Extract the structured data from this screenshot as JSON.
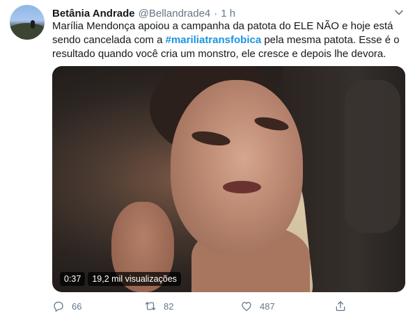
{
  "tweet": {
    "author": {
      "display_name": "Betânia Andrade",
      "handle": "@Bellandrade4",
      "separator": "·",
      "timestamp": "1 h",
      "avatar_icon": "avatar-photo"
    },
    "text": {
      "part1": "Marília Mendonça apoiou a campanha da patota do ELE NÃO e hoje está sendo cancelada com a ",
      "hashtag": "#mariliatransfobica",
      "part2": " pela mesma patota. Esse é o resultado quando você cria um monstro, ele cresce e depois lhe devora."
    },
    "media": {
      "type": "video",
      "duration": "0:37",
      "views": "19,2 mil visualizações"
    },
    "actions": {
      "reply": {
        "icon": "reply-icon",
        "count": "66"
      },
      "retweet": {
        "icon": "retweet-icon",
        "count": "82"
      },
      "like": {
        "icon": "heart-icon",
        "count": "487"
      },
      "share": {
        "icon": "share-icon"
      }
    },
    "menu_icon": "chevron-down-icon"
  },
  "colors": {
    "text": "#14171a",
    "secondary": "#657786",
    "hashtag": "#1b95e0"
  }
}
